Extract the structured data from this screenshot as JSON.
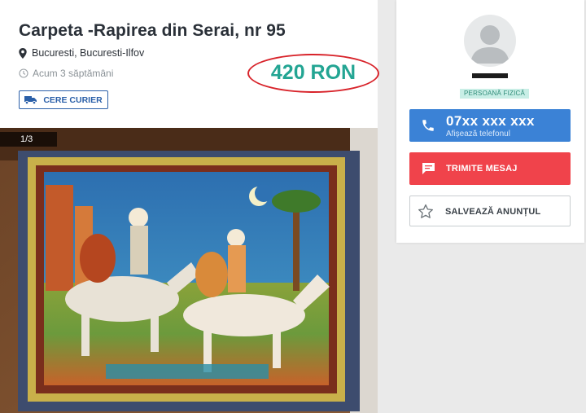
{
  "listing": {
    "title": "Carpeta -Rapirea din Serai, nr 95",
    "location": "Bucuresti, Bucuresti-Ilfov",
    "posted": "Acum 3 săptămâni",
    "courier_label": "CERE CURIER",
    "price": "420 RON",
    "photo_counter": "1/3"
  },
  "seller": {
    "type_badge": "PERSOANĂ FIZICĂ",
    "phone": "07xx xxx xxx",
    "phone_hint": "Afișează telefonul",
    "message_label": "TRIMITE MESAJ",
    "save_label": "SALVEAZĂ ANUNȚUL"
  },
  "icons": {
    "location": "map-pin-icon",
    "posted": "clock-icon",
    "courier": "truck-icon",
    "phone": "phone-icon",
    "message": "chat-bubble-icon",
    "save": "star-icon",
    "avatar": "user-silhouette-icon"
  },
  "colors": {
    "price": "#23a593",
    "price_ring": "#d8232a",
    "phone_button": "#3b82d6",
    "message_button": "#f0434b",
    "courier_accent": "#2a5fa8",
    "badge_bg": "#c8eee6"
  }
}
